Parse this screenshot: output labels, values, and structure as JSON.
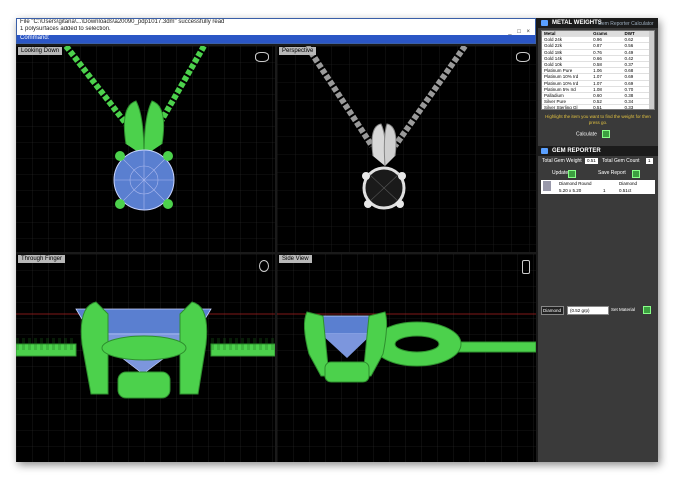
{
  "command": {
    "line1": "File \"C:\\Users\\gitana\\...\\Downloads\\a20090_pdp1017.3dm\" successfully read",
    "line2": "1 polysurfaces added to selection.",
    "prompt": "Command:",
    "controls": "_ □ ×"
  },
  "viewports": {
    "top_left": {
      "label": "Looking Down"
    },
    "top_right": {
      "label": "Perspective"
    },
    "bottom_left": {
      "label": "Through Finger"
    },
    "bottom_right": {
      "label": "Side View"
    }
  },
  "metal_weights": {
    "title": "METAL WEIGHTS",
    "tab": "Gem Reporter Calculator",
    "headers": [
      "Metal",
      "Grams",
      "DWT"
    ],
    "rows": [
      [
        "Gold 24k",
        "0.96",
        "0.62"
      ],
      [
        "Gold 22k",
        "0.87",
        "0.56"
      ],
      [
        "Gold 18k",
        "0.76",
        "0.49"
      ],
      [
        "Gold 14k",
        "0.66",
        "0.42"
      ],
      [
        "Gold 10k",
        "0.58",
        "0.37"
      ],
      [
        "Platinum Pure",
        "1.06",
        "0.68"
      ],
      [
        "Platinum 10% Ird",
        "1.07",
        "0.69"
      ],
      [
        "Platinum 10% Ird",
        "1.07",
        "0.69"
      ],
      [
        "Platinum 5% Ird",
        "1.08",
        "0.70"
      ],
      [
        "Palladium",
        "0.60",
        "0.38"
      ],
      [
        "Silver Pure",
        "0.52",
        "0.34"
      ],
      [
        "Silver Sterling Gl",
        "0.51",
        "0.33"
      ]
    ],
    "hint": "Highlight the item you want to find the weight for then press go.",
    "calculate_label": "Calculate"
  },
  "gem_reporter": {
    "title": "GEM REPORTER",
    "total_weight_label": "Total Gem Weight",
    "total_weight_value": "0.51",
    "total_count_label": "Total Gem Count",
    "total_count_value": "1",
    "update_label": "Update",
    "save_label": "Save Report",
    "gem_headers": [
      "Diamond Round",
      "Diamond"
    ],
    "gem_size": "5.20 x 5.20",
    "gem_count": "1",
    "gem_weight": "0.51ct"
  },
  "material": {
    "selected": "Diamond",
    "weight_option": "(0.52 grp)",
    "set_label": "Set Material"
  },
  "colors": {
    "metal_green": "#4cd14c",
    "stone_blue": "#5a7fd0",
    "grid": "#2b2b2b",
    "grid_axis_red": "#aa2222",
    "grid_axis_green": "#22aa22"
  }
}
